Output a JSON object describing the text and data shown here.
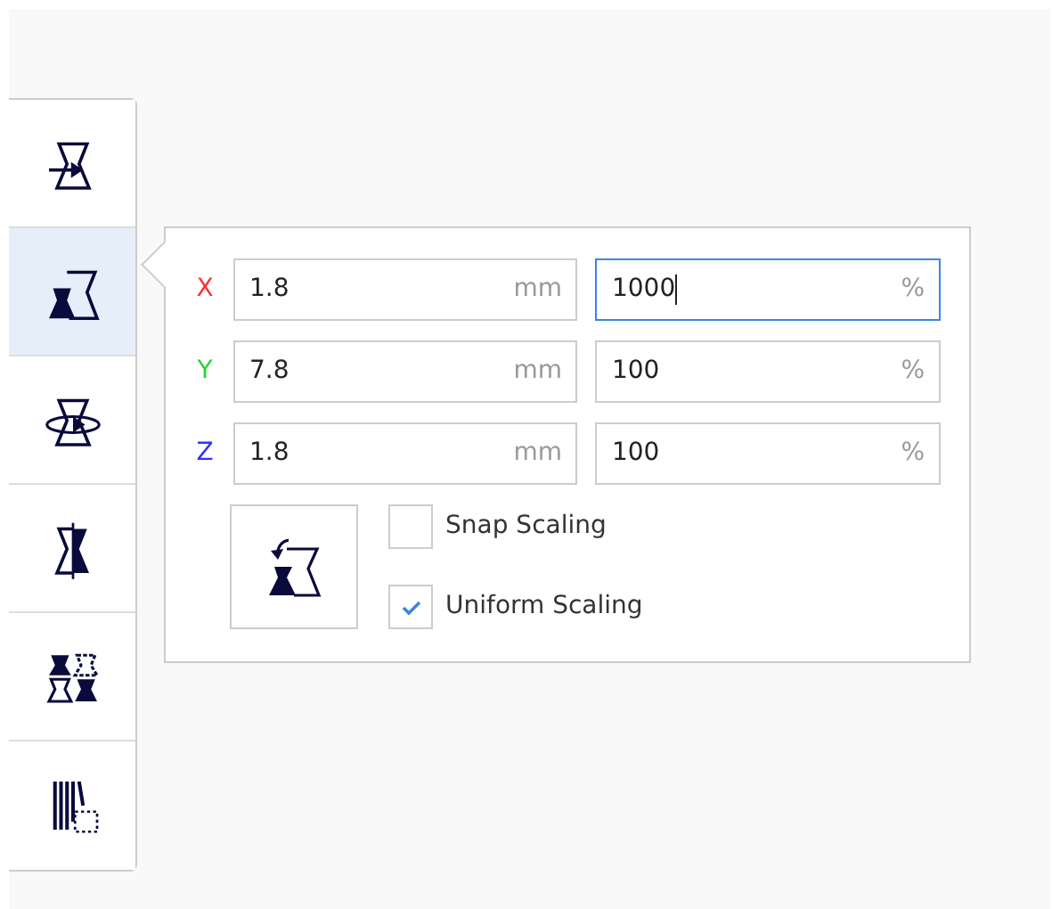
{
  "toolbar": [
    {
      "kind": "move",
      "selected": false
    },
    {
      "kind": "scale",
      "selected": true
    },
    {
      "kind": "rotate",
      "selected": false
    },
    {
      "kind": "mirror",
      "selected": false
    },
    {
      "kind": "per-model",
      "selected": false
    },
    {
      "kind": "support-blocker",
      "selected": false
    }
  ],
  "scale_panel": {
    "axes": [
      {
        "label": "X",
        "color": "#ff3030",
        "size": "1.8",
        "size_unit": "mm",
        "percent": "1000",
        "percent_unit": "%",
        "focused": true
      },
      {
        "label": "Y",
        "color": "#30d030",
        "size": "7.8",
        "size_unit": "mm",
        "percent": "100",
        "percent_unit": "%",
        "focused": false
      },
      {
        "label": "Z",
        "color": "#3030ff",
        "size": "1.8",
        "size_unit": "mm",
        "percent": "100",
        "percent_unit": "%",
        "focused": false
      }
    ],
    "options": [
      {
        "label": "Snap Scaling",
        "checked": false
      },
      {
        "label": "Uniform Scaling",
        "checked": true
      }
    ]
  }
}
